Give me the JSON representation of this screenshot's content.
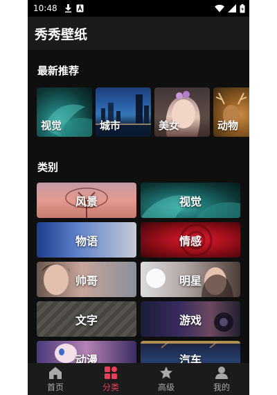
{
  "status_bar": {
    "time": "10:48",
    "icons_left": [
      "download-icon",
      "a-notification-icon"
    ],
    "icons_right": [
      "wifi-icon",
      "signal-icon",
      "battery-icon"
    ]
  },
  "app_title": "秀秀壁纸",
  "recommended": {
    "title": "最新推荐",
    "items": [
      {
        "label": "视觉"
      },
      {
        "label": "城市"
      },
      {
        "label": "美女"
      },
      {
        "label": "动物"
      }
    ]
  },
  "categories": {
    "title": "类别",
    "items": [
      {
        "label": "风景"
      },
      {
        "label": "视觉"
      },
      {
        "label": "物语"
      },
      {
        "label": "情感"
      },
      {
        "label": "帅哥"
      },
      {
        "label": "明星"
      },
      {
        "label": "文字"
      },
      {
        "label": "游戏"
      },
      {
        "label": "动漫"
      },
      {
        "label": "汽车"
      }
    ]
  },
  "bottom_nav": {
    "items": [
      {
        "label": "首页",
        "icon": "home-icon",
        "active": false
      },
      {
        "label": "分类",
        "icon": "category-icon",
        "active": true
      },
      {
        "label": "高级",
        "icon": "star-icon",
        "active": false
      },
      {
        "label": "我的",
        "icon": "person-icon",
        "active": false
      }
    ],
    "active_color": "#e8405a",
    "inactive_color": "#a8a8a8"
  }
}
